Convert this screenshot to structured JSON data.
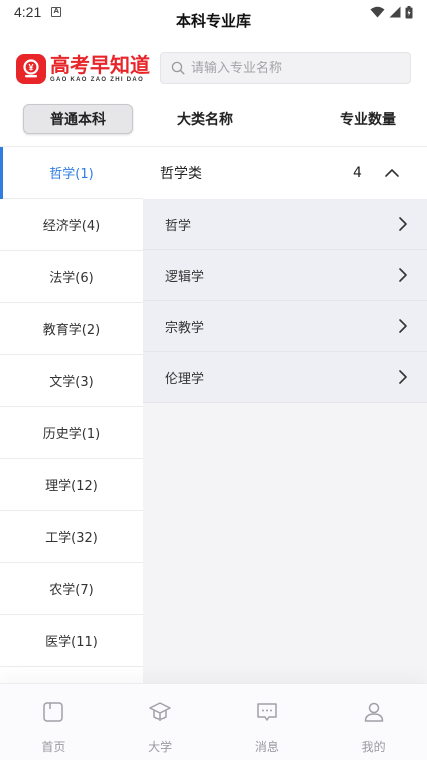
{
  "status_bar": {
    "time": "4:21"
  },
  "header": {
    "title": "本科专业库"
  },
  "logo": {
    "text": "高考早知道",
    "subtext": "GAO KAO ZAO ZHI DAO"
  },
  "search": {
    "placeholder": "请输入专业名称"
  },
  "columns": {
    "category": "普通本科",
    "major_name": "大类名称",
    "count": "专业数量"
  },
  "sidebar": {
    "items": [
      {
        "label": "哲学(1)",
        "active": true
      },
      {
        "label": "经济学(4)"
      },
      {
        "label": "法学(6)"
      },
      {
        "label": "教育学(2)"
      },
      {
        "label": "文学(3)"
      },
      {
        "label": "历史学(1)"
      },
      {
        "label": "理学(12)"
      },
      {
        "label": "工学(32)"
      },
      {
        "label": "农学(7)"
      },
      {
        "label": "医学(11)"
      }
    ]
  },
  "group": {
    "name": "哲学类",
    "count": "4",
    "majors": [
      "哲学",
      "逻辑学",
      "宗教学",
      "伦理学"
    ]
  },
  "tabs": [
    {
      "label": "首页",
      "icon": "home-icon"
    },
    {
      "label": "大学",
      "icon": "graduation-cap-icon"
    },
    {
      "label": "消息",
      "icon": "message-icon"
    },
    {
      "label": "我的",
      "icon": "user-icon"
    }
  ],
  "colors": {
    "accent": "#2f7de1",
    "brand": "#e8262a"
  }
}
